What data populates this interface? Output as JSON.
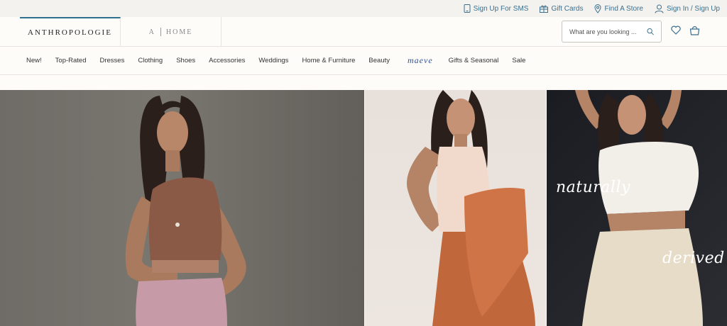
{
  "utility": {
    "sms": "Sign Up For SMS",
    "gift": "Gift Cards",
    "store": "Find A Store",
    "signin": "Sign In / Sign Up"
  },
  "header": {
    "brand": "ANTHROPOLOGIE",
    "home_left": "A",
    "home_right": "HOME",
    "search_placeholder": "What are you looking ..."
  },
  "nav": {
    "items": [
      "New!",
      "Top-Rated",
      "Dresses",
      "Clothing",
      "Shoes",
      "Accessories",
      "Weddings",
      "Home & Furniture",
      "Beauty",
      "maeve",
      "Gifts & Seasonal",
      "Sale"
    ]
  },
  "hero": {
    "script1": "naturally",
    "script2": "derived"
  },
  "colors": {
    "accent": "#2f6f8f",
    "link": "#3a6f8f"
  }
}
